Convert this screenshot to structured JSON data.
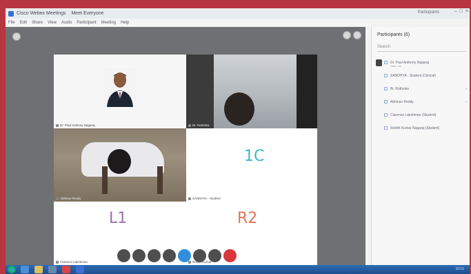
{
  "window": {
    "title": "Cisco Webex Meetings",
    "subtitle": "Meet Everyone",
    "right_text": "Participants",
    "controls": [
      "–",
      "□",
      "×"
    ]
  },
  "menu": [
    "File",
    "Edit",
    "Share",
    "View",
    "Audio",
    "Participant",
    "Meeting",
    "Help"
  ],
  "tiles": [
    {
      "label": "Dr. Paul Anthony Nagaraj",
      "type": "photo"
    },
    {
      "label": "Br. Ruthvika",
      "type": "camera"
    },
    {
      "label": "Abhinav Reddy",
      "type": "camera"
    },
    {
      "label": "SANDHYA - Student",
      "big_text": "1C"
    },
    {
      "label": "Clarence Lakshman",
      "big_text": "L1"
    },
    {
      "label": "Rohith Kumar",
      "big_text": "R2"
    }
  ],
  "participants": {
    "title": "Participants (6)",
    "search_placeholder": "Search",
    "items": [
      {
        "name": "Dr. Paul Anthony Nagaraj",
        "sub": "Host, me",
        "host": true
      },
      {
        "name": "SANDHYA - Student (Clinical)",
        "sub": ""
      },
      {
        "name": "Br. Ruthvika",
        "sub": ""
      },
      {
        "name": "Abhinav Reddy",
        "sub": ""
      },
      {
        "name": "Clarence Lakshman (Student)",
        "sub": ""
      },
      {
        "name": "Rohith Kumar Nagaraj (Student)",
        "sub": ""
      }
    ]
  },
  "controls": [
    "mute",
    "video",
    "share",
    "record",
    "participants",
    "chat",
    "more",
    "end"
  ],
  "tray": {
    "clock": "10:15"
  }
}
